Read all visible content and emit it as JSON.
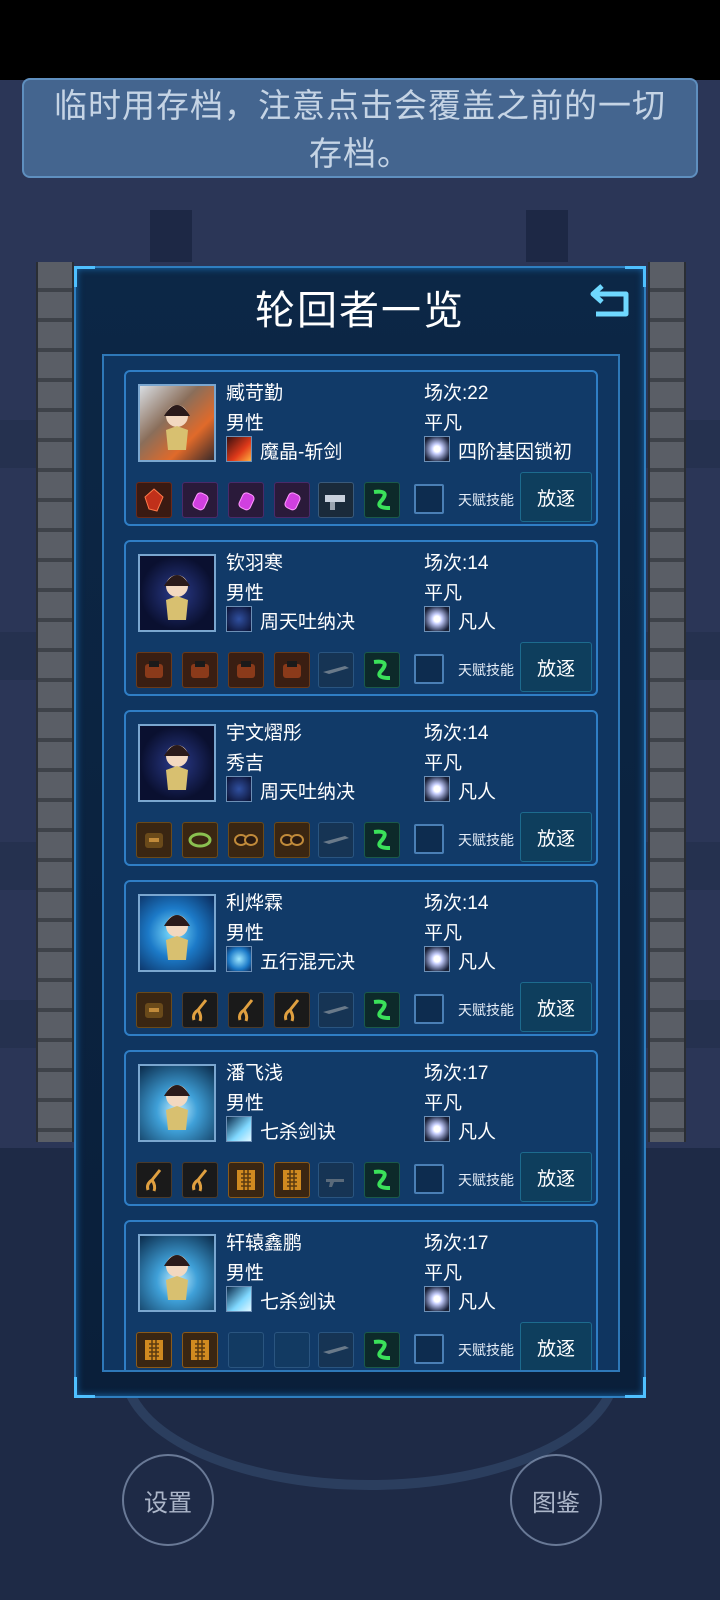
{
  "notice": {
    "line1": "临时用存档，注意点击会覆盖之前的一切",
    "line2": "存档。"
  },
  "panel": {
    "title": "轮回者一览",
    "back_icon": "return-arrow-icon"
  },
  "labels": {
    "talent_skill": "天赋技能",
    "exile": "放逐"
  },
  "bottom": {
    "settings": "设置",
    "codex": "图鉴"
  },
  "characters": [
    {
      "name": "臧苛勤",
      "gender": "男性",
      "skill": "魔晶-斩剑",
      "skill_icon": "red-sword-icon",
      "round": "场次:22",
      "rank": "平凡",
      "talent": "四阶基因锁初",
      "items": [
        "red-crystal",
        "purple-potion",
        "purple-potion",
        "purple-potion",
        "gun",
        "green-snake"
      ]
    },
    {
      "name": "钦羽寒",
      "gender": "男性",
      "skill": "周天吐纳决",
      "skill_icon": "constellation-icon",
      "round": "场次:14",
      "rank": "平凡",
      "talent": "凡人",
      "items": [
        "armor",
        "armor",
        "armor",
        "armor",
        "rifle",
        "green-snake"
      ]
    },
    {
      "name": "宇文熠彤",
      "gender": "秀吉",
      "skill": "周天吐纳决",
      "skill_icon": "constellation-icon",
      "round": "场次:14",
      "rank": "平凡",
      "talent": "凡人",
      "items": [
        "backpack",
        "ring",
        "goggles",
        "goggles",
        "rifle",
        "green-snake"
      ]
    },
    {
      "name": "利烨霖",
      "gender": "男性",
      "skill": "五行混元决",
      "skill_icon": "vortex-icon",
      "round": "场次:14",
      "rank": "平凡",
      "talent": "凡人",
      "items": [
        "backpack",
        "claw",
        "claw",
        "claw",
        "rifle",
        "green-snake"
      ]
    },
    {
      "name": "潘飞浅",
      "gender": "男性",
      "skill": "七杀剑诀",
      "skill_icon": "ice-sword-icon",
      "round": "场次:17",
      "rank": "平凡",
      "talent": "凡人",
      "items": [
        "claw",
        "claw",
        "crate",
        "crate",
        "pistol",
        "green-snake"
      ]
    },
    {
      "name": "轩辕鑫鹏",
      "gender": "男性",
      "skill": "七杀剑诀",
      "skill_icon": "ice-sword-icon",
      "round": "场次:17",
      "rank": "平凡",
      "talent": "凡人",
      "items": [
        "crate",
        "crate",
        "empty",
        "empty",
        "rifle",
        "green-snake"
      ]
    }
  ],
  "colors": {
    "accent": "#2f7ec5",
    "panel_bg": "#0c2746",
    "card_bg": "#113a68",
    "exile_bg": "#0e3e5d"
  }
}
